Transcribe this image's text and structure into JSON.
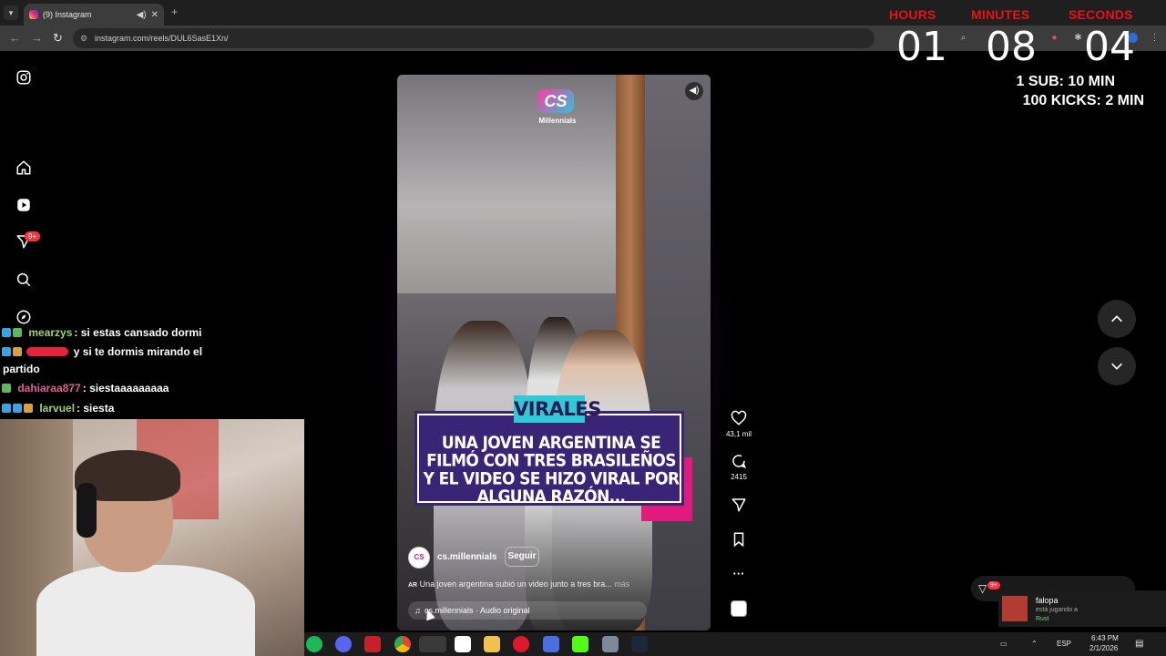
{
  "browser": {
    "tab_title": "(9) Instagram",
    "url": "instagram.com/reels/DUL6SasE1Xn/",
    "audio_icon": "speaker-icon",
    "close_icon": "close-icon"
  },
  "timer": {
    "hours_label": "HOURS",
    "minutes_label": "MINUTES",
    "seconds_label": "SECONDS",
    "hours": "01",
    "minutes": "08",
    "seconds": "04",
    "rule1": "1 SUB: 10 MIN",
    "rule2": "100 KICKS: 2 MIN",
    "label_color": "#e8111a"
  },
  "instagram": {
    "notification_badge": "9+",
    "sidebar_icons": [
      "instagram-logo-icon",
      "home-icon",
      "reels-icon",
      "messages-icon",
      "search-icon",
      "explore-icon"
    ]
  },
  "reel": {
    "logo_mark": "CS",
    "logo_text": "Millennials",
    "tag": "VIRALES",
    "headline": "UNA JOVEN ARGENTINA SE FILMÓ CON TRES BRASILEÑOS Y EL VIDEO SE HIZO VIRAL POR ALGUNA RAZÓN...",
    "author": "cs.millennials",
    "follow_label": "Seguir",
    "caption_prefix": "AR",
    "caption": "Una joven argentina subió un video junto a tres bra...",
    "caption_more": "más",
    "audio": "cs.millennials · Audio original",
    "likes": "43,1 mil",
    "comments": "2415",
    "tag_color": "#31c9d8",
    "box_color": "#3a2476",
    "accent_color": "#e21a7e"
  },
  "chat": [
    {
      "user": "mearzys",
      "user_color": "#9ed36a",
      "message": ": si estas cansado dormi"
    },
    {
      "user": "",
      "user_color": "#ff4f6a",
      "message": "y si te dormis mirando el",
      "message2": "partido"
    },
    {
      "user": "dahiaraa877",
      "user_color": "#e05d9a",
      "message": ": siestaaaaaaaaa"
    },
    {
      "user": "larvuel",
      "user_color": "#9ed36a",
      "message": ": siesta"
    }
  ],
  "notification": {
    "name": "falopa",
    "status": "está jugando a",
    "game": "Rust",
    "badge": "9+"
  },
  "taskbar": {
    "language": "ESP",
    "time": "6:43 PM",
    "date": "2/1/2026"
  }
}
